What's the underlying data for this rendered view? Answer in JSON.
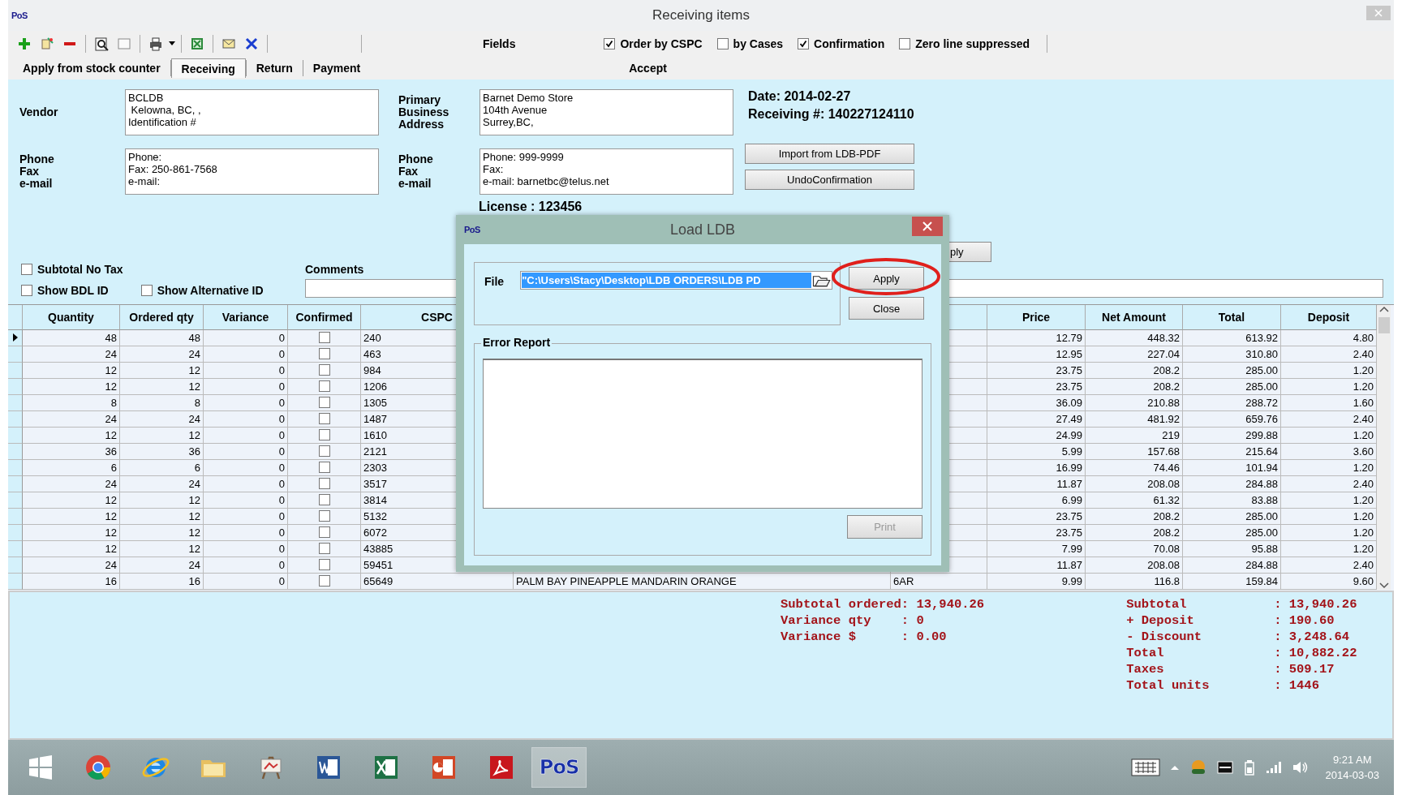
{
  "window": {
    "app_badge": "PoS",
    "title": "Receiving items"
  },
  "toolbar": {
    "fields_label": "Fields",
    "options": [
      {
        "label": "Order by CSPC",
        "checked": true
      },
      {
        "label": "by Cases",
        "checked": false
      },
      {
        "label": "Confirmation",
        "checked": true
      },
      {
        "label": "Zero line suppressed",
        "checked": false
      }
    ]
  },
  "tabs": [
    {
      "label": "Apply from stock counter",
      "selected": false
    },
    {
      "label": "Receiving",
      "selected": true
    },
    {
      "label": "Return",
      "selected": false
    },
    {
      "label": "Payment",
      "selected": false
    }
  ],
  "accept_button": "Accept",
  "vendor": {
    "label": "Vendor",
    "address": "BCLDB\n Kelowna, BC, ,\nIdentification #",
    "contact_labels": [
      "Phone",
      "Fax",
      "e-mail"
    ],
    "contact": "Phone:\nFax: 250-861-7568\ne-mail:"
  },
  "store": {
    "labels": [
      "Primary",
      "Business",
      "Address"
    ],
    "address": "Barnet Demo Store\n104th Avenue\nSurrey,BC,",
    "contact_labels": [
      "Phone",
      "Fax",
      "e-mail"
    ],
    "contact": "Phone: 999-9999\nFax:\ne-mail: barnetbc@telus.net",
    "license": "License :  123456"
  },
  "receipt": {
    "date": "Date: 2014-02-27",
    "receiving_no": "Receiving #: 140227124110"
  },
  "actions": [
    "Import from LDB-PDF",
    "UndoConfirmation"
  ],
  "partial_button": "ply",
  "options": [
    {
      "label": "Subtotal No Tax",
      "checked": false
    },
    {
      "label": "Show BDL ID",
      "checked": false
    },
    {
      "label": "Show Alternative ID",
      "checked": false
    }
  ],
  "comments": {
    "label": "Comments"
  },
  "table": {
    "columns": [
      "Quantity",
      "Ordered qty",
      "Variance",
      "Confirmed",
      "CSPC",
      "Price",
      "Net Amount",
      "Total",
      "Deposit"
    ],
    "rows": [
      {
        "selected": true,
        "quantity": "48",
        "ordered_qty": "48",
        "variance": "0",
        "confirmed": false,
        "cspc": "240",
        "price": "12.79",
        "net_amount": "448.32",
        "total": "613.92",
        "deposit": "4.80"
      },
      {
        "selected": false,
        "quantity": "24",
        "ordered_qty": "24",
        "variance": "0",
        "confirmed": false,
        "cspc": "463",
        "price": "12.95",
        "net_amount": "227.04",
        "total": "310.80",
        "deposit": "2.40"
      },
      {
        "selected": false,
        "quantity": "12",
        "ordered_qty": "12",
        "variance": "0",
        "confirmed": false,
        "cspc": "984",
        "price": "23.75",
        "net_amount": "208.2",
        "total": "285.00",
        "deposit": "1.20"
      },
      {
        "selected": false,
        "quantity": "12",
        "ordered_qty": "12",
        "variance": "0",
        "confirmed": false,
        "cspc": "1206",
        "price": "23.75",
        "net_amount": "208.2",
        "total": "285.00",
        "deposit": "1.20"
      },
      {
        "selected": false,
        "quantity": "8",
        "ordered_qty": "8",
        "variance": "0",
        "confirmed": false,
        "cspc": "1305",
        "price": "36.09",
        "net_amount": "210.88",
        "total": "288.72",
        "deposit": "1.60"
      },
      {
        "selected": false,
        "quantity": "24",
        "ordered_qty": "24",
        "variance": "0",
        "confirmed": false,
        "cspc": "1487",
        "price": "27.49",
        "net_amount": "481.92",
        "total": "659.76",
        "deposit": "2.40"
      },
      {
        "selected": false,
        "quantity": "12",
        "ordered_qty": "12",
        "variance": "0",
        "confirmed": false,
        "cspc": "1610",
        "price": "24.99",
        "net_amount": "219",
        "total": "299.88",
        "deposit": "1.20"
      },
      {
        "selected": false,
        "quantity": "36",
        "ordered_qty": "36",
        "variance": "0",
        "confirmed": false,
        "cspc": "2121",
        "price": "5.99",
        "net_amount": "157.68",
        "total": "215.64",
        "deposit": "3.60"
      },
      {
        "selected": false,
        "quantity": "6",
        "ordered_qty": "6",
        "variance": "0",
        "confirmed": false,
        "cspc": "2303",
        "price": "16.99",
        "net_amount": "74.46",
        "total": "101.94",
        "deposit": "1.20"
      },
      {
        "selected": false,
        "quantity": "24",
        "ordered_qty": "24",
        "variance": "0",
        "confirmed": false,
        "cspc": "3517",
        "price": "11.87",
        "net_amount": "208.08",
        "total": "284.88",
        "deposit": "2.40"
      },
      {
        "selected": false,
        "quantity": "12",
        "ordered_qty": "12",
        "variance": "0",
        "confirmed": false,
        "cspc": "3814",
        "price": "6.99",
        "net_amount": "61.32",
        "total": "83.88",
        "deposit": "1.20"
      },
      {
        "selected": false,
        "quantity": "12",
        "ordered_qty": "12",
        "variance": "0",
        "confirmed": false,
        "cspc": "5132",
        "price": "23.75",
        "net_amount": "208.2",
        "total": "285.00",
        "deposit": "1.20"
      },
      {
        "selected": false,
        "quantity": "12",
        "ordered_qty": "12",
        "variance": "0",
        "confirmed": false,
        "cspc": "6072",
        "price": "23.75",
        "net_amount": "208.2",
        "total": "285.00",
        "deposit": "1.20"
      },
      {
        "selected": false,
        "quantity": "12",
        "ordered_qty": "12",
        "variance": "0",
        "confirmed": false,
        "cspc": "43885",
        "price": "7.99",
        "net_amount": "70.08",
        "total": "95.88",
        "deposit": "1.20"
      },
      {
        "selected": false,
        "quantity": "24",
        "ordered_qty": "24",
        "variance": "0",
        "confirmed": false,
        "cspc": "59451",
        "price": "11.87",
        "net_amount": "208.08",
        "total": "284.88",
        "deposit": "2.40"
      },
      {
        "selected": false,
        "quantity": "16",
        "ordered_qty": "16",
        "variance": "0",
        "confirmed": false,
        "cspc": "65649",
        "column_6": "PALM BAY PINEAPPLE MANDARIN ORANGE",
        "column_7": "6AR",
        "price": "9.99",
        "net_amount": "116.8",
        "total": "159.84",
        "deposit": "9.60"
      }
    ]
  },
  "summary": {
    "left": [
      {
        "label": "Subtotal ordered",
        "value": ": 13,940.26"
      },
      {
        "label": "Variance qty",
        "value": ": 0"
      },
      {
        "label": "Variance $",
        "value": ": 0.00"
      }
    ],
    "right": [
      {
        "label": "Subtotal",
        "value": ": 13,940.26"
      },
      {
        "label": "+ Deposit",
        "value": ": 190.60"
      },
      {
        "label": "- Discount",
        "value": ": 3,248.64"
      },
      {
        "label": "Total",
        "value": ": 10,882.22"
      },
      {
        "label": "Taxes",
        "value": ": 509.17"
      },
      {
        "label": "Total units",
        "value": ": 1446"
      }
    ]
  },
  "dialog": {
    "badge": "PoS",
    "title": "Load LDB",
    "file_label": "File",
    "file_value": "\"C:\\Users\\Stacy\\Desktop\\LDB ORDERS\\LDB PD",
    "buttons": [
      {
        "label": "Apply",
        "highlighted": true
      },
      {
        "label": "Close",
        "highlighted": false
      }
    ],
    "error_report_label": "Error Report",
    "print_button": {
      "label": "Print",
      "disabled": true
    }
  },
  "taskbar": {
    "apps": [
      {
        "kind": "start",
        "active": false
      },
      {
        "kind": "round-browser",
        "active": false
      },
      {
        "kind": "ring-browser",
        "active": false
      },
      {
        "kind": "folder",
        "active": false
      },
      {
        "kind": "easel",
        "active": false
      },
      {
        "kind": "word",
        "active": false
      },
      {
        "kind": "sheet",
        "active": false
      },
      {
        "kind": "slides",
        "active": false
      },
      {
        "kind": "pdf",
        "active": false
      },
      {
        "kind": "pos",
        "label": "PoS",
        "active": true
      }
    ],
    "time": "9:21 AM",
    "date": "2014-03-03"
  }
}
